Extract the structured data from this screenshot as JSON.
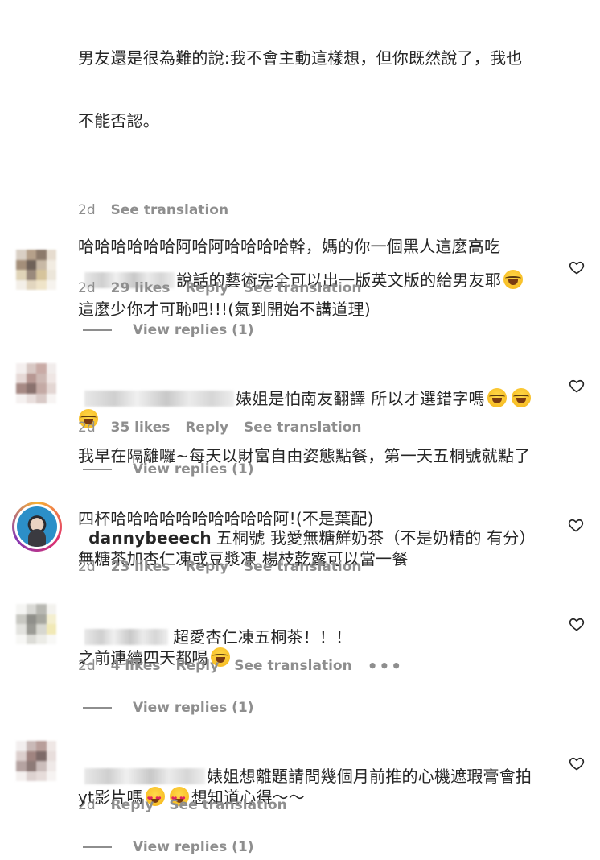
{
  "top_comment": {
    "lines": [
      "男友還是很為難的說:我不會主動這樣想，但你既然說了，我也",
      "不能否認。",
      "哈哈哈哈哈哈阿哈阿哈哈哈哈幹，媽的你一個黑人這麼高吃",
      "這麼少你才可恥吧!!!(氣到開始不講道理)",
      "我早在隔離囉~每天以財富自由姿態點餐，第一天五桐號就點了",
      "四杯哈哈哈哈哈哈哈哈哈哈阿!(不是葉配)"
    ],
    "time": "2d",
    "see_translation": "See translation"
  },
  "comments": [
    {
      "username": "",
      "text_line1": "說話的藝術完全可以出一版英文版的給男友耶",
      "text_line2": "",
      "time": "2d",
      "likes": "29 likes",
      "reply": "Reply",
      "see_translation": "See translation",
      "view_replies": "View replies (1)"
    },
    {
      "username": "",
      "text_line1": "婊姐是怕南友翻譯 所以才選錯字嗎",
      "text_line2": "",
      "time": "2d",
      "likes": "35 likes",
      "reply": "Reply",
      "see_translation": "See translation",
      "view_replies": "View replies (1)"
    },
    {
      "username": "dannybeeech",
      "text_line1": "五桐號 我愛無糖鮮奶茶（不是奶精的 有分）",
      "text_line2": "無糖茶加杏仁凍或豆漿凍 楊枝乾露可以當一餐",
      "time": "2d",
      "likes": "23 likes",
      "reply": "Reply",
      "see_translation": "See translation"
    },
    {
      "username": "",
      "text_line1": "超愛杏仁凍五桐茶！！！",
      "text_line2": "之前連續四天都喝",
      "time": "2d",
      "likes": "4 likes",
      "reply": "Reply",
      "see_translation": "See translation",
      "more": "•••",
      "view_replies": "View replies (1)"
    },
    {
      "username": "",
      "text_line1": "婊姐想離題請問幾個月前推的心機遮瑕膏會拍",
      "text_line2_a": "yt影片嗎",
      "text_line2_b": "想知道心得～～",
      "time": "2d",
      "reply": "Reply",
      "see_translation": "See translation",
      "view_replies": "View replies (1)"
    }
  ],
  "icons": {
    "like": "heart-outline-icon",
    "laugh": "tears-of-joy-emoji",
    "love": "heart-eyes-emoji"
  },
  "colors": {
    "text": "#262626",
    "secondary": "#8e8e8e",
    "background": "#ffffff"
  }
}
